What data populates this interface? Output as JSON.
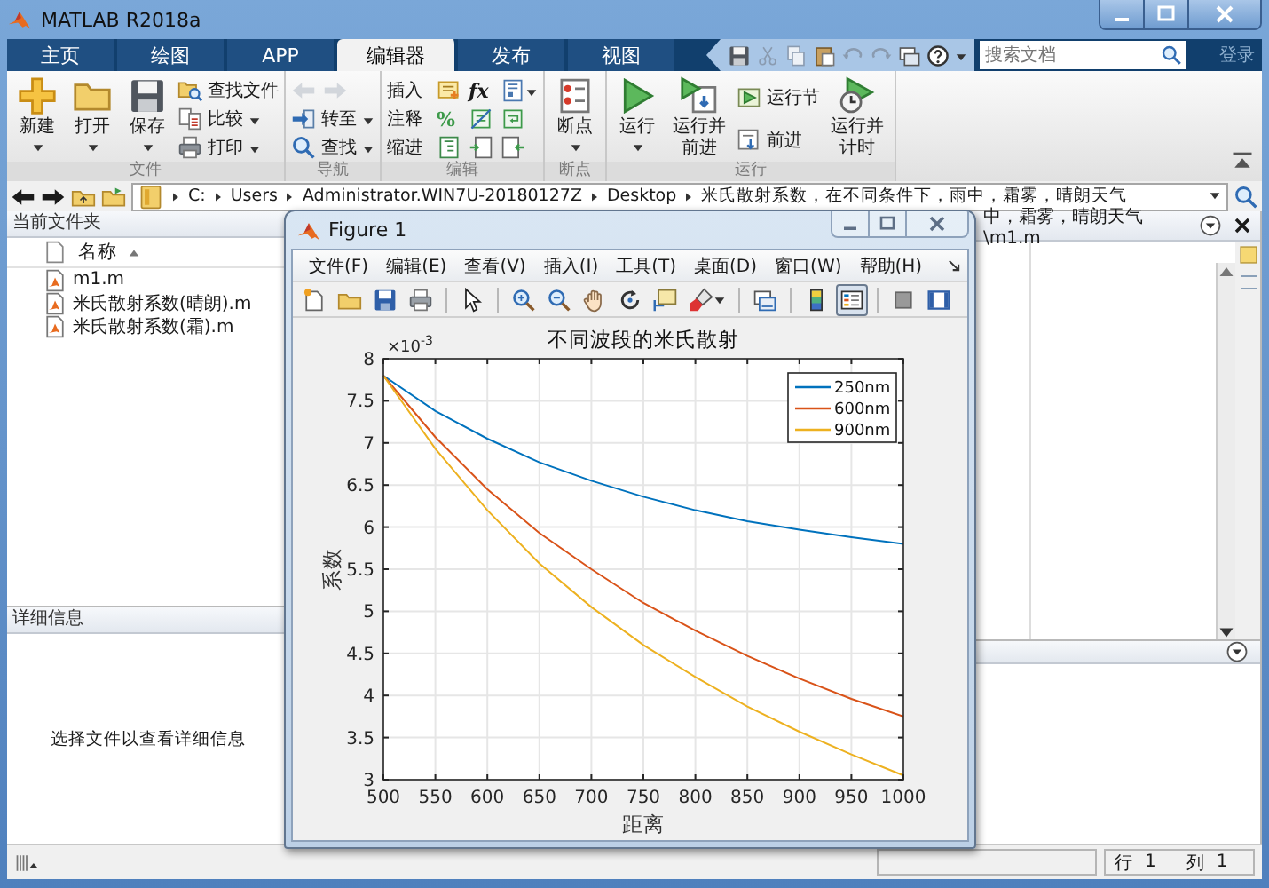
{
  "window": {
    "title": "MATLAB R2018a"
  },
  "tabs": [
    {
      "label": "主页",
      "selected": false
    },
    {
      "label": "绘图",
      "selected": false
    },
    {
      "label": "APP",
      "selected": false
    },
    {
      "label": "编辑器",
      "selected": true
    },
    {
      "label": "发布",
      "selected": false
    },
    {
      "label": "视图",
      "selected": false
    }
  ],
  "search": {
    "placeholder": "搜索文档"
  },
  "sign_in": "登录",
  "ribbon": {
    "groups": [
      {
        "label": "文件",
        "columns": [
          {
            "kind": "large",
            "label": "新建",
            "dropdown": true
          },
          {
            "kind": "large",
            "label": "打开",
            "dropdown": true
          },
          {
            "kind": "large",
            "label": "保存",
            "dropdown": true
          },
          {
            "kind": "stack",
            "rows": [
              [
                {
                  "kind": "icon-text",
                  "label": "查找文件",
                  "dropdown": false
                }
              ],
              [
                {
                  "kind": "icon-text",
                  "label": "比较",
                  "dropdown": true
                }
              ],
              [
                {
                  "kind": "icon-text",
                  "label": "打印",
                  "dropdown": true
                }
              ]
            ]
          }
        ]
      },
      {
        "label": "导航",
        "columns": [
          {
            "kind": "stack",
            "rows": [
              [
                {
                  "kind": "icon",
                  "disabled": true
                },
                {
                  "kind": "icon",
                  "disabled": true
                }
              ],
              [
                {
                  "kind": "icon-text",
                  "label": "转至",
                  "dropdown": true
                }
              ],
              [
                {
                  "kind": "icon-text",
                  "label": "查找",
                  "dropdown": true
                }
              ]
            ]
          }
        ]
      },
      {
        "label": "编辑",
        "columns": [
          {
            "kind": "stack",
            "rows": [
              [
                {
                  "kind": "text",
                  "label": "插入"
                },
                {
                  "kind": "icon"
                },
                {
                  "kind": "glyph",
                  "label": "fx"
                },
                {
                  "kind": "icon",
                  "dropdown": true
                }
              ],
              [
                {
                  "kind": "text",
                  "label": "注释"
                },
                {
                  "kind": "glyph",
                  "label": "%"
                },
                {
                  "kind": "icon"
                },
                {
                  "kind": "icon"
                }
              ],
              [
                {
                  "kind": "text",
                  "label": "缩进"
                },
                {
                  "kind": "icon"
                },
                {
                  "kind": "icon"
                },
                {
                  "kind": "icon"
                }
              ]
            ]
          }
        ]
      },
      {
        "label": "断点",
        "columns": [
          {
            "kind": "large",
            "label": "断点",
            "dropdown": true
          }
        ]
      },
      {
        "label": "运行",
        "columns": [
          {
            "kind": "large",
            "label": "运行",
            "dropdown": true
          },
          {
            "kind": "large",
            "label": "运行并前进",
            "dropdown": false
          },
          {
            "kind": "stack",
            "rows": [
              [
                {
                  "kind": "icon-text",
                  "label": "运行节",
                  "dropdown": false
                }
              ],
              [
                {
                  "kind": "icon-text",
                  "label": "前进",
                  "dropdown": false
                }
              ]
            ]
          },
          {
            "kind": "large",
            "label": "运行并计时",
            "dropdown": false
          }
        ]
      }
    ]
  },
  "address": {
    "path": [
      "C:",
      "Users",
      "Administrator.WIN7U-20180127Z",
      "Desktop",
      "米氏散射系数，在不同条件下，雨中，霜雾，晴朗天气"
    ]
  },
  "current_folder": {
    "title": "当前文件夹",
    "column": "名称",
    "files": [
      {
        "name": "m1.m",
        "selected": false
      },
      {
        "name": "米氏散射系数(晴朗).m",
        "selected": false
      },
      {
        "name": "米氏散射系数(霜).m",
        "selected": false
      }
    ]
  },
  "details": {
    "title": "详细信息",
    "message": "选择文件以查看详细信息"
  },
  "editor": {
    "tab_title": "中，霜雾，晴朗天气\\m1.m"
  },
  "status_bar": {
    "line_label": "行",
    "line": "1",
    "column_label": "列",
    "column": "1"
  },
  "figure": {
    "title": "Figure 1",
    "menu": [
      "文件(F)",
      "编辑(E)",
      "查看(V)",
      "插入(I)",
      "工具(T)",
      "桌面(D)",
      "窗口(W)",
      "帮助(H)"
    ],
    "toolbar_groups": [
      [
        {
          "pressed": false,
          "dropdown": false
        },
        {
          "pressed": false,
          "dropdown": false
        },
        {
          "pressed": false,
          "dropdown": false
        },
        {
          "pressed": false,
          "dropdown": false
        }
      ],
      [
        {
          "pressed": false,
          "dropdown": false
        }
      ],
      [
        {
          "pressed": false,
          "dropdown": false
        },
        {
          "pressed": false,
          "dropdown": false
        },
        {
          "pressed": false,
          "dropdown": false
        },
        {
          "pressed": false,
          "dropdown": false
        },
        {
          "pressed": false,
          "dropdown": false
        },
        {
          "pressed": false,
          "dropdown": true
        }
      ],
      [
        {
          "pressed": false,
          "dropdown": false
        }
      ],
      [
        {
          "pressed": false,
          "dropdown": false
        },
        {
          "pressed": true,
          "dropdown": false
        }
      ],
      [
        {
          "pressed": false,
          "dropdown": false
        },
        {
          "pressed": false,
          "dropdown": false
        }
      ]
    ],
    "axes": {
      "exponent_base": "×10",
      "exponent_power": "-3",
      "chart_data": {
        "type": "line",
        "title": "不同波段的米氏散射",
        "xlabel": "距离",
        "ylabel": "系数",
        "x": [
          500,
          550,
          600,
          650,
          700,
          750,
          800,
          850,
          900,
          950,
          1000
        ],
        "series": [
          {
            "name": "250nm",
            "color": "#0072bd",
            "values": [
              7.8,
              7.38,
              7.05,
              6.77,
              6.55,
              6.36,
              6.2,
              6.07,
              5.97,
              5.88,
              5.8
            ]
          },
          {
            "name": "600nm",
            "color": "#d95319",
            "values": [
              7.8,
              7.07,
              6.45,
              5.93,
              5.5,
              5.1,
              4.77,
              4.47,
              4.2,
              3.96,
              3.75
            ]
          },
          {
            "name": "900nm",
            "color": "#edb120",
            "values": [
              7.8,
              6.93,
              6.2,
              5.57,
              5.05,
              4.6,
              4.22,
              3.87,
              3.57,
              3.3,
              3.05
            ]
          }
        ],
        "xlim": [
          500,
          1000
        ],
        "ylim": [
          3,
          8
        ],
        "xticks": [
          500,
          550,
          600,
          650,
          700,
          750,
          800,
          850,
          900,
          950,
          1000
        ],
        "yticks": [
          3,
          3.5,
          4,
          4.5,
          5,
          5.5,
          6,
          6.5,
          7,
          7.5,
          8
        ],
        "grid": true,
        "legend": "top right"
      }
    }
  }
}
